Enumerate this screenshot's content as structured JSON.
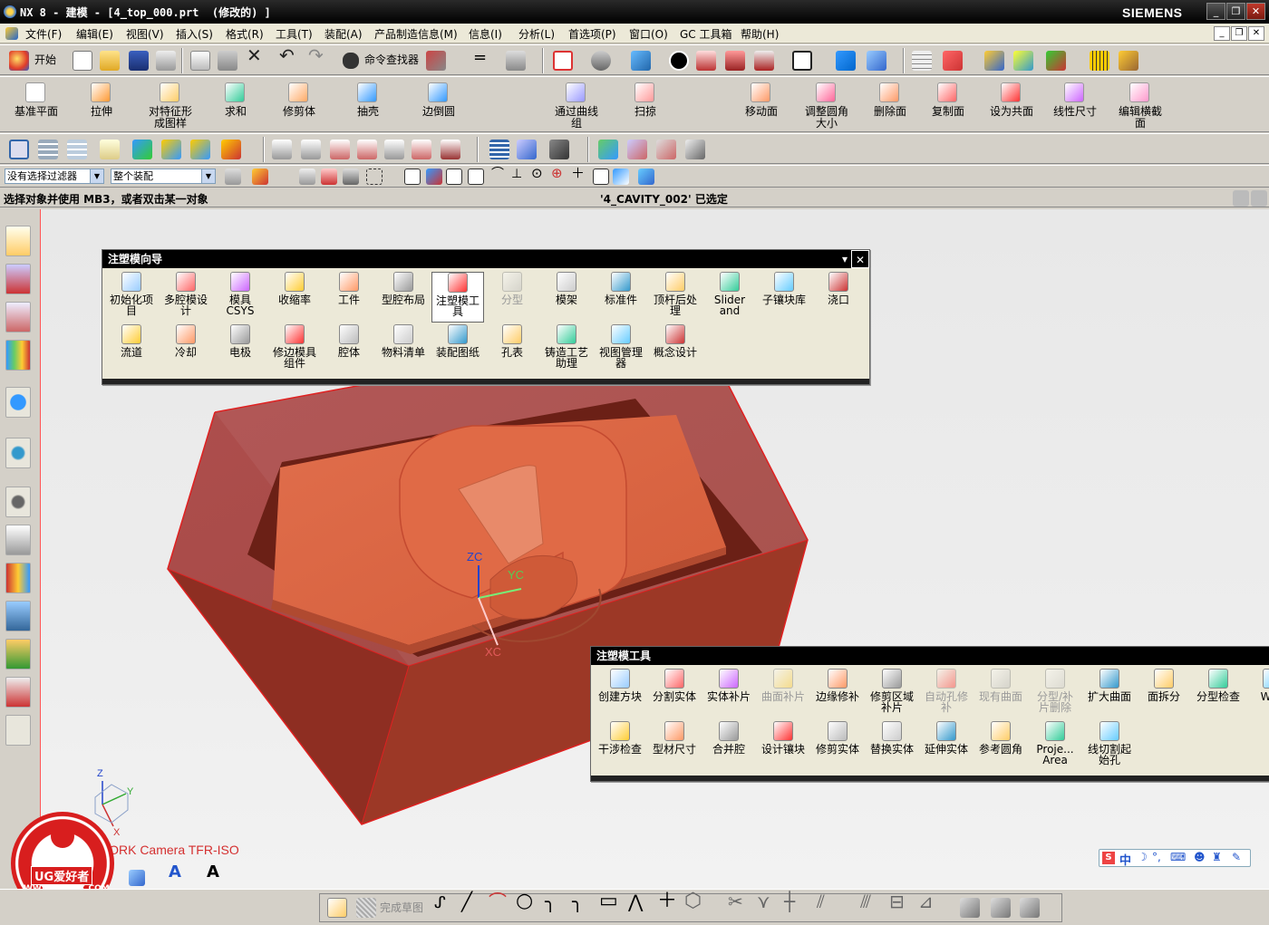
{
  "window": {
    "title": "NX 8 - 建模 - [4_top_000.prt  (修改的) ]",
    "brand": "SIEMENS"
  },
  "menu": [
    "文件(F)",
    "编辑(E)",
    "视图(V)",
    "插入(S)",
    "格式(R)",
    "工具(T)",
    "装配(A)",
    "产品制造信息(M)",
    "信息(I)",
    "分析(L)",
    "首选项(P)",
    "窗口(O)",
    "GC 工具箱",
    "帮助(H)"
  ],
  "toolbar1": {
    "start_label": "开始",
    "command_finder_label": "命令查找器"
  },
  "toolbar2": {
    "items": [
      {
        "label": "基准平面",
        "icon": "datum-plane-icon"
      },
      {
        "label": "拉伸",
        "icon": "extrude-icon"
      },
      {
        "label": "对特征形\n成图样",
        "icon": "pattern-feature-icon"
      },
      {
        "label": "求和",
        "icon": "unite-icon"
      },
      {
        "label": "修剪体",
        "icon": "trim-body-icon"
      },
      {
        "label": "抽壳",
        "icon": "shell-icon"
      },
      {
        "label": "边倒圆",
        "icon": "edge-blend-icon"
      },
      {
        "label": "通过曲线\n组",
        "icon": "through-curves-icon"
      },
      {
        "label": "扫掠",
        "icon": "swept-icon"
      },
      {
        "label": "移动面",
        "icon": "move-face-icon"
      },
      {
        "label": "调整圆角\n大小",
        "icon": "resize-blend-icon"
      },
      {
        "label": "删除面",
        "icon": "delete-face-icon"
      },
      {
        "label": "复制面",
        "icon": "copy-face-icon"
      },
      {
        "label": "设为共面",
        "icon": "make-coplanar-icon"
      },
      {
        "label": "线性尺寸",
        "icon": "linear-dimension-icon"
      },
      {
        "label": "编辑横截\n面",
        "icon": "edit-section-icon"
      }
    ]
  },
  "selection": {
    "filter": "没有选择过滤器",
    "scope": "整个装配"
  },
  "status": {
    "prompt": "选择对象并使用 MB3，或者双击某一对象",
    "selected": "'4_CAVITY_002' 已选定"
  },
  "mold_wizard": {
    "title": "注塑模向导",
    "row1": [
      {
        "label": "初始化项\n目",
        "icon": "init-project-icon",
        "enabled": true
      },
      {
        "label": "多腔模设\n计",
        "icon": "family-mold-icon",
        "enabled": true
      },
      {
        "label": "模具\nCSYS",
        "icon": "mold-csys-icon",
        "enabled": true
      },
      {
        "label": "收缩率",
        "icon": "shrinkage-icon",
        "enabled": true
      },
      {
        "label": "工件",
        "icon": "workpiece-icon",
        "enabled": true
      },
      {
        "label": "型腔布局",
        "icon": "cavity-layout-icon",
        "enabled": true
      },
      {
        "label": "注塑模工\n具",
        "icon": "mold-tools-icon",
        "enabled": true
      },
      {
        "label": "分型",
        "icon": "parting-icon",
        "enabled": false
      },
      {
        "label": "模架",
        "icon": "mold-base-icon",
        "enabled": true
      },
      {
        "label": "标准件",
        "icon": "standard-part-icon",
        "enabled": true
      },
      {
        "label": "顶杆后处\n理",
        "icon": "ejector-pin-icon",
        "enabled": true
      },
      {
        "label": "Slider\nand",
        "icon": "slider-icon",
        "enabled": true
      },
      {
        "label": "子镶块库",
        "icon": "insert-library-icon",
        "enabled": true
      },
      {
        "label": "浇口",
        "icon": "gate-icon",
        "enabled": true
      }
    ],
    "row2": [
      {
        "label": "流道",
        "icon": "runner-icon",
        "enabled": true
      },
      {
        "label": "冷却",
        "icon": "cooling-icon",
        "enabled": true
      },
      {
        "label": "电极",
        "icon": "electrode-icon",
        "enabled": true
      },
      {
        "label": "修边模具\n组件",
        "icon": "trim-component-icon",
        "enabled": true
      },
      {
        "label": "腔体",
        "icon": "pocket-icon",
        "enabled": true
      },
      {
        "label": "物料清单",
        "icon": "bom-icon",
        "enabled": true
      },
      {
        "label": "装配图纸",
        "icon": "assembly-drawing-icon",
        "enabled": true
      },
      {
        "label": "孔表",
        "icon": "hole-table-icon",
        "enabled": true
      },
      {
        "label": "铸造工艺\n助理",
        "icon": "casting-assistant-icon",
        "enabled": true
      },
      {
        "label": "视图管理\n器",
        "icon": "view-manager-icon",
        "enabled": true
      },
      {
        "label": "概念设计",
        "icon": "concept-design-icon",
        "enabled": true
      }
    ]
  },
  "mold_tools": {
    "title": "注塑模工具",
    "row1": [
      {
        "label": "创建方块",
        "icon": "create-box-icon",
        "enabled": true
      },
      {
        "label": "分割实体",
        "icon": "split-solid-icon",
        "enabled": true
      },
      {
        "label": "实体补片",
        "icon": "solid-patch-icon",
        "enabled": true
      },
      {
        "label": "曲面补片",
        "icon": "surface-patch-icon",
        "enabled": false
      },
      {
        "label": "边缘修补",
        "icon": "edge-patch-icon",
        "enabled": true
      },
      {
        "label": "修剪区域\n补片",
        "icon": "trim-region-patch-icon",
        "enabled": true
      },
      {
        "label": "自动孔修\n补",
        "icon": "auto-hole-patch-icon",
        "enabled": false
      },
      {
        "label": "现有曲面",
        "icon": "existing-surface-icon",
        "enabled": false
      },
      {
        "label": "分型/补\n片删除",
        "icon": "delete-patch-icon",
        "enabled": false
      },
      {
        "label": "扩大曲面",
        "icon": "enlarge-surface-icon",
        "enabled": true
      },
      {
        "label": "面拆分",
        "icon": "face-split-icon",
        "enabled": true
      },
      {
        "label": "分型检查",
        "icon": "parting-check-icon",
        "enabled": true
      },
      {
        "label": "WAV",
        "icon": "wave-icon",
        "enabled": true
      }
    ],
    "row2": [
      {
        "label": "干涉检查",
        "icon": "interference-check-icon",
        "enabled": true
      },
      {
        "label": "型材尺寸",
        "icon": "stock-size-icon",
        "enabled": true
      },
      {
        "label": "合并腔",
        "icon": "merge-cavity-icon",
        "enabled": true
      },
      {
        "label": "设计镶块",
        "icon": "design-insert-icon",
        "enabled": true
      },
      {
        "label": "修剪实体",
        "icon": "trim-solid-icon",
        "enabled": true
      },
      {
        "label": "替换实体",
        "icon": "replace-solid-icon",
        "enabled": true
      },
      {
        "label": "延伸实体",
        "icon": "extend-solid-icon",
        "enabled": true
      },
      {
        "label": "参考圆角",
        "icon": "reference-blend-icon",
        "enabled": true
      },
      {
        "label": "Proje...\nArea",
        "icon": "project-area-icon",
        "enabled": true
      },
      {
        "label": "线切割起\n始孔",
        "icon": "wire-start-hole-icon",
        "enabled": true
      }
    ]
  },
  "viewport": {
    "view_label": "TFR-ISO WORK Camera TFR-ISO",
    "axes": {
      "z": "ZC",
      "y": "YC",
      "x": "XC"
    },
    "triad": {
      "z": "Z",
      "y": "Y",
      "x": "X"
    }
  },
  "watermark": {
    "brand": "UG爱好者",
    "url": "WWW.UGSNX.COM"
  },
  "bottom_toolbar": {
    "finish_sketch": "完成草图"
  },
  "ime": {
    "lang": "中"
  }
}
